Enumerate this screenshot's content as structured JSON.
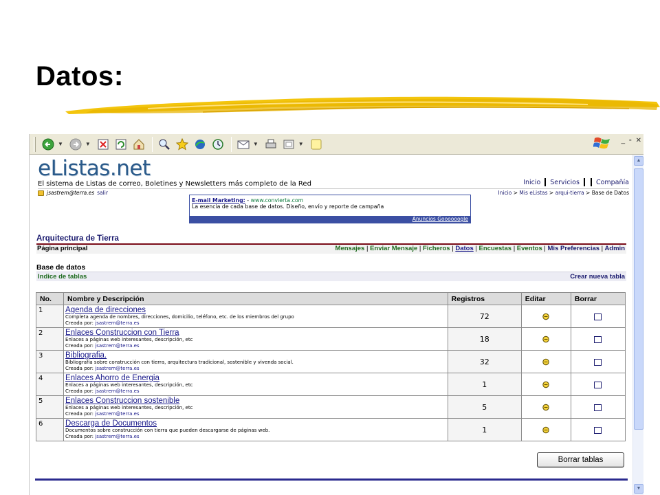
{
  "slide": {
    "title": "Datos",
    "colon": ":"
  },
  "toolbar": {
    "icons": [
      "back-icon",
      "forward-icon",
      "stop-icon",
      "refresh-icon",
      "home-icon",
      "search-icon",
      "favorites-icon",
      "media-icon",
      "history-icon",
      "mail-icon",
      "print-icon",
      "edit-icon",
      "messenger-icon"
    ],
    "win_controls": [
      "_",
      "▫",
      "✕"
    ]
  },
  "site": {
    "logo": "eListas.net",
    "tagline": "El sistema de Listas de correo, Boletines y Newsletters más completo de la Red",
    "topnav": [
      "Inicio",
      "Servicios",
      "Compañía"
    ],
    "user_email": "jsastrem@terra.es",
    "user_logout": "salir",
    "breadcrumb": {
      "inicio": "Inicio",
      "mis": "Mis eListas",
      "arqui": "arqui-tierra",
      "current": "Base de Datos",
      "sep": ">"
    }
  },
  "ad": {
    "title": "E-mail Marketing:",
    "dash": " - ",
    "url": "www.convierta.com",
    "text": "La esencia de cada base de datos. Diseño, envío y reporte de campaña",
    "footer": "Anuncios Goooooogle"
  },
  "section": {
    "title": "Arquitectura de Tierra",
    "left": "Página principal",
    "nav": [
      "Mensajes",
      "Enviar Mensaje",
      "Ficheros",
      "Datos",
      "Encuestas",
      "Eventos",
      "Mis Preferencias",
      "Admin"
    ],
    "nav_sep": "|"
  },
  "db": {
    "title": "Base de datos",
    "index": "Indice de tablas",
    "create": "Crear nueva tabla"
  },
  "table": {
    "headers": [
      "No.",
      "Nombre y Descripción",
      "Registros",
      "Editar",
      "Borrar"
    ],
    "created_label": "Creada por: ",
    "rows": [
      {
        "no": "1",
        "name": "Agenda de direcciones",
        "desc": "Completa agenda de nombres, direcciones, domicilio, teléfono, etc. de los miembros del grupo",
        "by": "jsastrem@terra.es",
        "reg": "72"
      },
      {
        "no": "2",
        "name": "Enlaces Construccion con Tierra",
        "desc": "Enlaces a páginas web interesantes, descripción, etc",
        "by": "jsastrem@terra.es",
        "reg": "18"
      },
      {
        "no": "3",
        "name": "Bibliografia.",
        "desc": "Bibliografía sobre construcción con tierra, arquitectura tradicional, sostenible y vivenda social.",
        "by": "jsastrem@terra.es",
        "reg": "32"
      },
      {
        "no": "4",
        "name": "Enlaces Ahorro de Energia",
        "desc": "Enlaces a páginas web interesantes, descripción, etc",
        "by": "jsastrem@terra.es",
        "reg": "1"
      },
      {
        "no": "5",
        "name": "Enlaces Construccion sostenible",
        "desc": "Enlaces a páginas web interesantes, descripción, etc",
        "by": "jsastrem@terra.es",
        "reg": "5"
      },
      {
        "no": "6",
        "name": "Descarga de Documentos",
        "desc": "Documentos sobre construcción con tierra que pueden descargarse de páginas web.",
        "by": "jsastrem@terra.es",
        "reg": "1"
      }
    ]
  },
  "buttons": {
    "delete_tables": "Borrar tablas"
  },
  "colors": {
    "accent": "#1a1a6e",
    "stroke": "#f2c200",
    "section_line": "#7a0c18",
    "footer_line": "#2a2a8e"
  }
}
